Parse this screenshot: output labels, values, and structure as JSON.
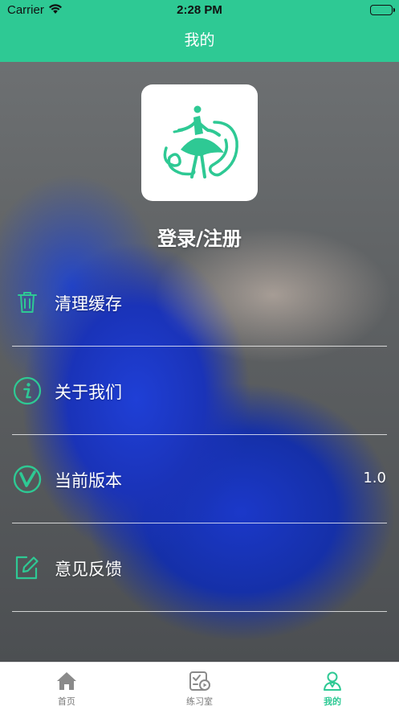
{
  "status_bar": {
    "carrier": "Carrier",
    "time": "2:28 PM"
  },
  "nav": {
    "title": "我的"
  },
  "profile": {
    "login_label": "登录/注册",
    "logo_icon": "ballerina-logo-icon"
  },
  "menu": [
    {
      "label": "清理缓存",
      "icon": "trash-icon",
      "value": ""
    },
    {
      "label": "关于我们",
      "icon": "info-icon",
      "value": ""
    },
    {
      "label": "当前版本",
      "icon": "version-icon",
      "value": "1.0"
    },
    {
      "label": "意见反馈",
      "icon": "edit-icon",
      "value": ""
    }
  ],
  "tabs": [
    {
      "label": "首页",
      "icon": "home-icon",
      "active": false
    },
    {
      "label": "练习室",
      "icon": "practice-room-icon",
      "active": false
    },
    {
      "label": "我的",
      "icon": "profile-icon",
      "active": true
    }
  ],
  "colors": {
    "accent": "#2ec994",
    "tab_inactive": "#8a8a8a"
  }
}
